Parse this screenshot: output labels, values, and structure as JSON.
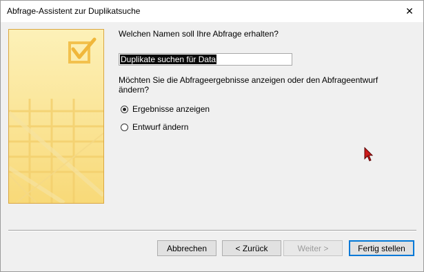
{
  "window": {
    "title": "Abfrage-Assistent zur Duplikatsuche",
    "close_glyph": "✕"
  },
  "form": {
    "name_question": "Welchen Namen soll Ihre Abfrage erhalten?",
    "name_value": "Duplikate suchen für Data",
    "view_question": "Möchten Sie die Abfrageergebnisse anzeigen oder den Abfrageentwurf ändern?",
    "options": [
      {
        "label": "Ergebnisse anzeigen",
        "checked": true
      },
      {
        "label": "Entwurf ändern",
        "checked": false
      }
    ]
  },
  "buttons": {
    "cancel": "Abbrechen",
    "back": "< Zurück",
    "next": "Weiter >",
    "finish": "Fertig stellen"
  },
  "colors": {
    "banner_fill": "#fbe79a",
    "banner_border": "#d9a640",
    "accent_blue": "#0078d7",
    "cursor_red": "#cc1b1b"
  }
}
